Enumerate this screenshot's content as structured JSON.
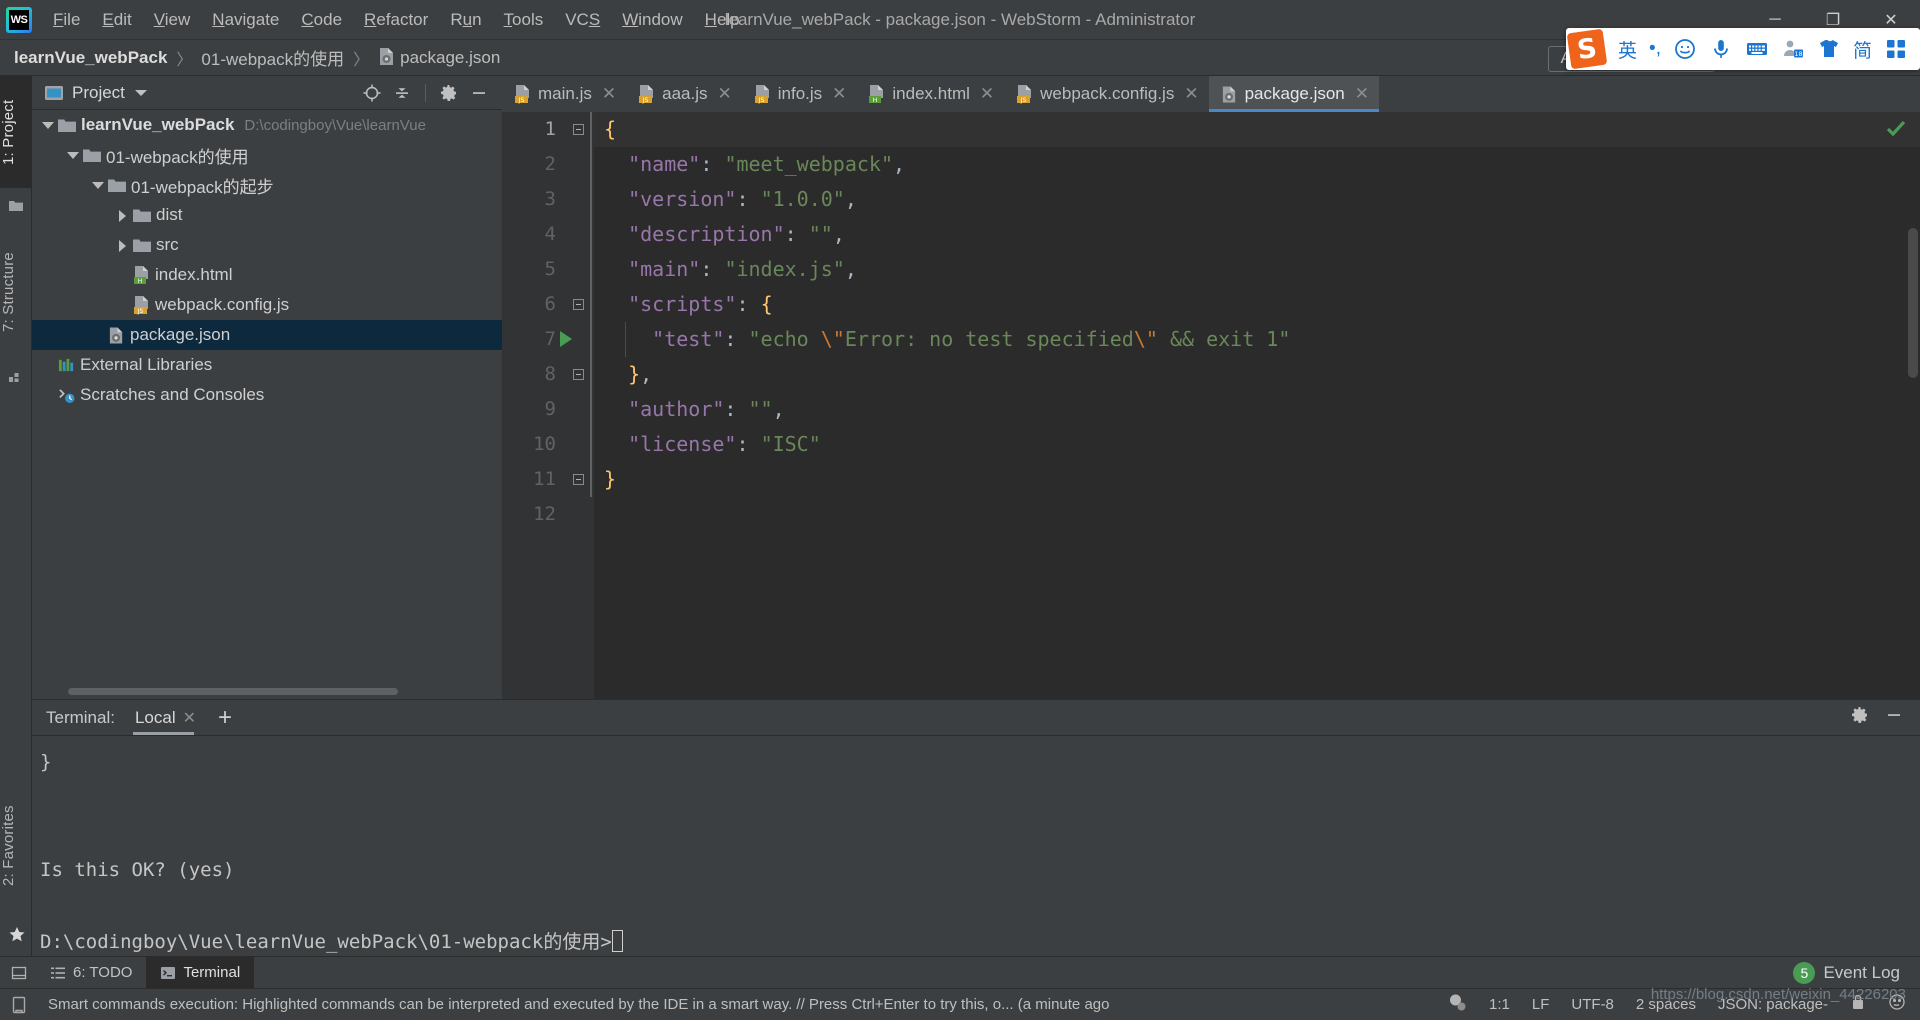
{
  "titlebar": {
    "logo": "webstorm-logo",
    "window_title": "learnVue_webPack - package.json - WebStorm - Administrator",
    "menus": [
      {
        "label": "File",
        "mnemonic": "F"
      },
      {
        "label": "Edit",
        "mnemonic": "E"
      },
      {
        "label": "View",
        "mnemonic": "V"
      },
      {
        "label": "Navigate",
        "mnemonic": "N"
      },
      {
        "label": "Code",
        "mnemonic": "C"
      },
      {
        "label": "Refactor",
        "mnemonic": "R"
      },
      {
        "label": "Run",
        "mnemonic": "u"
      },
      {
        "label": "Tools",
        "mnemonic": "T"
      },
      {
        "label": "VCS",
        "mnemonic": "S"
      },
      {
        "label": "Window",
        "mnemonic": "W"
      },
      {
        "label": "Help",
        "mnemonic": "H"
      }
    ],
    "window_buttons": {
      "minimize": "─",
      "maximize": "❐",
      "close": "✕"
    }
  },
  "navbar": {
    "breadcrumbs": [
      {
        "label": "learnVue_webPack",
        "bold": true,
        "icon": ""
      },
      {
        "label": "01-webpack的使用",
        "bold": false,
        "icon": ""
      },
      {
        "label": "package.json",
        "bold": false,
        "icon": "json-file-icon"
      }
    ],
    "separator": "〉",
    "add_configuration": "Add Configuration..."
  },
  "ime_toolbar": {
    "logo_letter": "S",
    "items": [
      {
        "name": "language-mode",
        "glyph": "英"
      },
      {
        "name": "punctuation-mode",
        "glyph": "•,"
      },
      {
        "name": "emoji-picker",
        "glyph": "smiley-icon"
      },
      {
        "name": "voice-input",
        "glyph": "microphone-icon"
      },
      {
        "name": "soft-keyboard",
        "glyph": "keyboard-icon"
      },
      {
        "name": "user-account",
        "glyph": "user-level-icon"
      },
      {
        "name": "skin-shirt",
        "glyph": "shirt-icon"
      },
      {
        "name": "simplified-chinese",
        "glyph": "简"
      },
      {
        "name": "toolbox",
        "glyph": "grid-icon"
      }
    ]
  },
  "left_strip": {
    "tabs": [
      {
        "label": "1: Project",
        "active": true,
        "icon": "folder-icon"
      },
      {
        "label": "7: Structure",
        "active": false,
        "icon": "structure-icon"
      }
    ]
  },
  "left_bottom_strip": {
    "tabs": [
      {
        "label": "2: Favorites",
        "icon": "star-icon"
      }
    ]
  },
  "project_window": {
    "title": "Project",
    "actions": [
      {
        "name": "select-opened-file-icon"
      },
      {
        "name": "collapse-all-icon"
      },
      {
        "name": "settings-gear-icon"
      },
      {
        "name": "hide-icon"
      }
    ],
    "tree": [
      {
        "depth": 0,
        "arrow": "down",
        "icon": "folder",
        "label": "learnVue_webPack",
        "bold": true,
        "path": "D:\\codingboy\\Vue\\learnVue",
        "selected": false
      },
      {
        "depth": 1,
        "arrow": "down",
        "icon": "folder",
        "label": "01-webpack的使用",
        "bold": false,
        "path": "",
        "selected": false
      },
      {
        "depth": 2,
        "arrow": "down",
        "icon": "folder",
        "label": "01-webpack的起步",
        "bold": false,
        "path": "",
        "selected": false
      },
      {
        "depth": 3,
        "arrow": "right",
        "icon": "folder",
        "label": "dist",
        "bold": false,
        "path": "",
        "selected": false
      },
      {
        "depth": 3,
        "arrow": "right",
        "icon": "folder",
        "label": "src",
        "bold": false,
        "path": "",
        "selected": false
      },
      {
        "depth": 3,
        "arrow": "none",
        "icon": "html",
        "label": "index.html",
        "bold": false,
        "path": "",
        "selected": false
      },
      {
        "depth": 3,
        "arrow": "none",
        "icon": "js",
        "label": "webpack.config.js",
        "bold": false,
        "path": "",
        "selected": false
      },
      {
        "depth": 2,
        "arrow": "none",
        "icon": "json",
        "label": "package.json",
        "bold": false,
        "path": "",
        "selected": true
      },
      {
        "depth": 0,
        "arrow": "none",
        "icon": "library",
        "label": "External Libraries",
        "bold": false,
        "path": "",
        "selected": false
      },
      {
        "depth": 0,
        "arrow": "none",
        "icon": "scratch",
        "label": "Scratches and Consoles",
        "bold": false,
        "path": "",
        "selected": false
      }
    ]
  },
  "editor": {
    "tabs": [
      {
        "label": "main.js",
        "icon": "js",
        "active": false,
        "close": "✕"
      },
      {
        "label": "aaa.js",
        "icon": "js",
        "active": false,
        "close": "✕"
      },
      {
        "label": "info.js",
        "icon": "js",
        "active": false,
        "close": "✕"
      },
      {
        "label": "index.html",
        "icon": "html",
        "active": false,
        "close": "✕"
      },
      {
        "label": "webpack.config.js",
        "icon": "js",
        "active": false,
        "close": "✕"
      },
      {
        "label": "package.json",
        "icon": "json",
        "active": true,
        "close": "✕"
      }
    ],
    "line_numbers": [
      "1",
      "2",
      "3",
      "4",
      "5",
      "6",
      "7",
      "8",
      "9",
      "10",
      "11",
      "12"
    ],
    "current_line": 1,
    "file_name": "package.json",
    "code_lines": [
      {
        "n": 1,
        "raw": "{"
      },
      {
        "n": 2,
        "raw": "  \"name\": \"meet_webpack\","
      },
      {
        "n": 3,
        "raw": "  \"version\": \"1.0.0\","
      },
      {
        "n": 4,
        "raw": "  \"description\": \"\","
      },
      {
        "n": 5,
        "raw": "  \"main\": \"index.js\","
      },
      {
        "n": 6,
        "raw": "  \"scripts\": {"
      },
      {
        "n": 7,
        "raw": "    \"test\": \"echo \\\"Error: no test specified\\\" && exit 1\""
      },
      {
        "n": 8,
        "raw": "  },"
      },
      {
        "n": 9,
        "raw": "  \"author\": \"\","
      },
      {
        "n": 10,
        "raw": "  \"license\": \"ISC\""
      },
      {
        "n": 11,
        "raw": "}"
      },
      {
        "n": 12,
        "raw": ""
      }
    ],
    "json_content": {
      "name": "meet_webpack",
      "version": "1.0.0",
      "description": "",
      "main": "index.js",
      "scripts": {
        "test": "echo \\\"Error: no test specified\\\" && exit 1"
      },
      "author": "",
      "license": "ISC"
    },
    "inspection_status": "ok-check-icon"
  },
  "terminal": {
    "label": "Terminal:",
    "tab": "Local",
    "tab_close": "✕",
    "add_tab": "+",
    "actions": [
      {
        "name": "settings-gear-icon"
      },
      {
        "name": "hide-icon"
      }
    ],
    "lines": [
      "}",
      "",
      "",
      "Is this OK? (yes)",
      "",
      "D:\\codingboy\\Vue\\learnVue_webPack\\01-webpack的使用>"
    ],
    "prompt": "D:\\codingboy\\Vue\\learnVue_webPack\\01-webpack的使用>"
  },
  "bottom_strip": {
    "tabs": [
      {
        "label": "6: TODO",
        "icon": "todo-icon",
        "active": false
      },
      {
        "label": "Terminal",
        "icon": "terminal-icon",
        "active": true
      }
    ],
    "event_log": {
      "count": "5",
      "label": "Event Log"
    }
  },
  "statusbar": {
    "message": "Smart commands execution: Highlighted commands can be interpreted and executed by the IDE in a smart way. // Press Ctrl+Enter to try this, o... (a minute ago",
    "items": [
      {
        "name": "caret-position",
        "label": "1:1"
      },
      {
        "name": "line-separator",
        "label": "LF"
      },
      {
        "name": "file-encoding",
        "label": "UTF-8"
      },
      {
        "name": "indent",
        "label": "2 spaces"
      },
      {
        "name": "file-type",
        "label": "JSON: package-"
      }
    ]
  },
  "watermark": "https://blog.csdn.net/weixin_44226203",
  "colors": {
    "ide_bg": "#3c3f41",
    "editor_bg": "#2b2b2b",
    "gutter_bg": "#313335",
    "selection_blue": "#0d293e",
    "accent_blue": "#4a88c7",
    "string_green": "#6a8759",
    "key_purple": "#9876aa",
    "escape_orange": "#cc7832",
    "brace_yellow": "#ffc66d",
    "ime_orange": "#f0631b",
    "ime_blue": "#1a76d2",
    "ok_green": "#499c54"
  }
}
